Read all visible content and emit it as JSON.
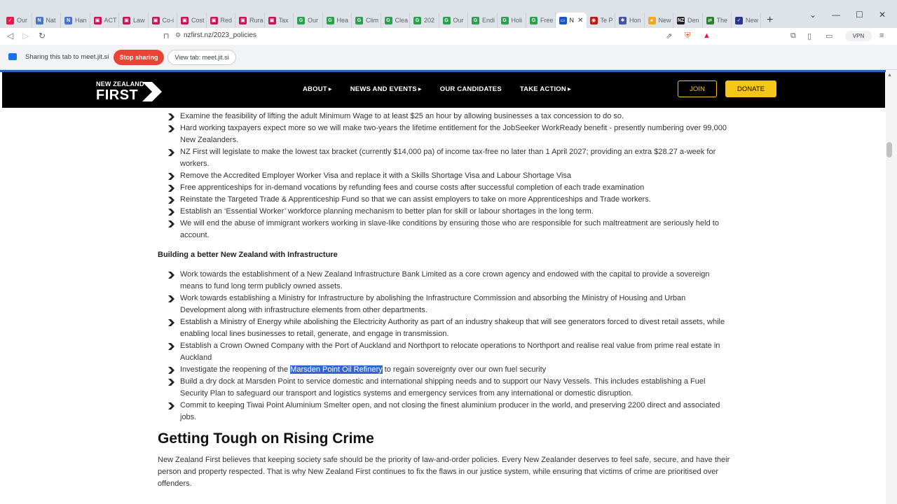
{
  "browser": {
    "tabs": [
      {
        "title": "Our",
        "color": "#e8194a",
        "glyph": "✓"
      },
      {
        "title": "Nat",
        "color": "#4b74c9",
        "glyph": "N"
      },
      {
        "title": "Han",
        "color": "#4b74c9",
        "glyph": "N"
      },
      {
        "title": "ACT",
        "color": "#c2185b",
        "glyph": "▣"
      },
      {
        "title": "Law",
        "color": "#c2185b",
        "glyph": "▣"
      },
      {
        "title": "Co-i",
        "color": "#c2185b",
        "glyph": "▣"
      },
      {
        "title": "Cost",
        "color": "#c2185b",
        "glyph": "▣"
      },
      {
        "title": "Red",
        "color": "#c2185b",
        "glyph": "▣"
      },
      {
        "title": "Rura",
        "color": "#c2185b",
        "glyph": "▣"
      },
      {
        "title": "Tax",
        "color": "#c2185b",
        "glyph": "▣"
      },
      {
        "title": "Our",
        "color": "#2e9e4f",
        "glyph": "G"
      },
      {
        "title": "Hea",
        "color": "#2e9e4f",
        "glyph": "G"
      },
      {
        "title": "Clim",
        "color": "#2e9e4f",
        "glyph": "G"
      },
      {
        "title": "Clea",
        "color": "#2e9e4f",
        "glyph": "G"
      },
      {
        "title": "202",
        "color": "#2e9e4f",
        "glyph": "G"
      },
      {
        "title": "Our",
        "color": "#2e9e4f",
        "glyph": "G"
      },
      {
        "title": "Endi",
        "color": "#2e9e4f",
        "glyph": "G"
      },
      {
        "title": "Holi",
        "color": "#2e9e4f",
        "glyph": "G"
      },
      {
        "title": "Free",
        "color": "#2e9e4f",
        "glyph": "G"
      },
      {
        "title": "N",
        "color": "#1a56c8",
        "glyph": "▭",
        "active": true
      },
      {
        "title": "Te P",
        "color": "#b71c1c",
        "glyph": "◉"
      },
      {
        "title": "Hon",
        "color": "#3f51b5",
        "glyph": "✱"
      },
      {
        "title": "New",
        "color": "#f9a825",
        "glyph": "●"
      },
      {
        "title": "Den",
        "color": "#212121",
        "glyph": "NZ"
      },
      {
        "title": "The",
        "color": "#2e7d32",
        "glyph": "⇄"
      },
      {
        "title": "New",
        "color": "#283593",
        "glyph": "✓"
      }
    ],
    "new_tab_label": "+",
    "url": "nzfirst.nz/2023_policies",
    "vpn_label": "VPN"
  },
  "sharing": {
    "text": "Sharing this tab to meet.jit.si",
    "stop_label": "Stop sharing",
    "view_label": "View tab: meet.jit.si"
  },
  "site": {
    "logo_top": "NEW ZEALAND",
    "logo_main": "FIRST",
    "nav": [
      {
        "label": "ABOUT",
        "caret": true
      },
      {
        "label": "NEWS AND EVENTS",
        "caret": true
      },
      {
        "label": "OUR CANDIDATES",
        "caret": false
      },
      {
        "label": "TAKE ACTION",
        "caret": true
      }
    ],
    "join_label": "JOIN",
    "donate_label": "DONATE",
    "accent": "#f5c518"
  },
  "content": {
    "list1": [
      "Examine the feasibility of lifting the adult Minimum Wage to at least $25 an hour by allowing businesses a tax concession to do so.",
      "Hard working taxpayers expect more so we will make two-years the lifetime entitlement for the JobSeeker WorkReady benefit - presently numbering over 99,000 New Zealanders.",
      "NZ First will legislate to make the lowest tax bracket (currently $14,000 pa) of income tax-free no later than 1 April 2027; providing an extra $28.27 a-week for workers.",
      "Remove the Accredited Employer Worker Visa and replace it with a Skills Shortage Visa and Labour Shortage Visa",
      "Free apprenticeships for in-demand vocations by refunding fees and course costs after successful completion of each trade examination",
      "Reinstate the Targeted Trade & Apprenticeship Fund so that we can assist employers to take on more Apprenticeships and Trade workers.",
      "Establish an ‘Essential Worker’ workforce planning mechanism to better plan for skill or labour shortages in the long term.",
      "We will end the abuse of immigrant workers working in slave-like conditions by ensuring those who are responsible for such maltreatment are seriously held to account."
    ],
    "section_heading": "Building a better New Zealand with Infrastructure",
    "list2": [
      "Work towards the establishment of a New Zealand Infrastructure Bank Limited as a core crown agency and endowed with the capital to provide a sovereign means to fund long term publicly owned assets.",
      "Work towards establishing a Ministry for Infrastructure by abolishing the Infrastructure Commission and absorbing the Ministry of Housing and Urban Development along with infrastructure elements from other departments.",
      "Establish a Ministry of Energy while abolishing the Electricity Authority as part of an industry shakeup that will see generators forced to divest retail assets, while enabling local lines businesses to retail, generate, and engage in transmission.",
      "Establish a Crown Owned Company with the Port of Auckland and Northport to relocate operations to Northport and realise real value from prime real estate in Auckland"
    ],
    "refinery_item": {
      "before": "Investigate the reopening of the ",
      "highlight": "Marsden Point Oil Refinery",
      "after": " to regain sovereignty over our own fuel security"
    },
    "list3": [
      "Build a dry dock at Marsden Point to service domestic and international shipping needs and to support our Navy Vessels. This includes establishing a Fuel Security Plan to safeguard our transport and logistics systems and emergency services from any international or domestic disruption.",
      "Commit to keeping Tiwai Point Aluminium Smelter open, and not closing the finest aluminium producer in the world, and preserving 2200 direct and associated jobs."
    ],
    "crime_heading": "Getting Tough on Rising Crime",
    "crime_para": "New Zealand First believes that keeping society safe should be the priority of law-and-order policies. Every New Zealander deserves to feel safe, secure, and have their person and property respected. That is why New Zealand First continues to fix the flaws in our justice system, while ensuring that victims of crime are prioritised over offenders."
  }
}
